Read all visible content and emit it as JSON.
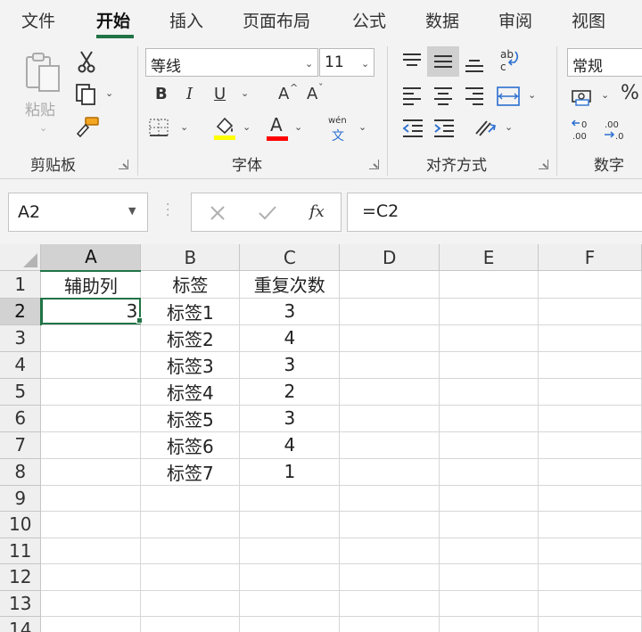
{
  "tabs": [
    "文件",
    "开始",
    "插入",
    "页面布局",
    "公式",
    "数据",
    "审阅",
    "视图"
  ],
  "active_tab": "开始",
  "ribbon": {
    "clipboard": {
      "paste_label": "粘贴",
      "group_label": "剪贴板"
    },
    "font": {
      "font_name": "等线",
      "font_size": "11",
      "bold": "B",
      "italic": "I",
      "underline": "U",
      "grow": "A",
      "shrink": "A",
      "font_color_letter": "A",
      "phonetic_top": "wén",
      "phonetic_bottom": "文",
      "group_label": "字体"
    },
    "alignment": {
      "group_label": "对齐方式"
    },
    "number": {
      "format": "常规",
      "percent": "%",
      "group_label": "数字"
    }
  },
  "formula_bar": {
    "name_box": "A2",
    "fx_label": "fx",
    "formula": "=C2"
  },
  "grid": {
    "columns": [
      "A",
      "B",
      "C",
      "D",
      "E",
      "F"
    ],
    "selected_column": "A",
    "selected_row": 2,
    "active_cell": "A2",
    "rows": [
      {
        "num": "1",
        "cells": [
          "辅助列",
          "标签",
          "重复次数",
          "",
          "",
          ""
        ]
      },
      {
        "num": "2",
        "cells": [
          "3",
          "标签1",
          "3",
          "",
          "",
          ""
        ]
      },
      {
        "num": "3",
        "cells": [
          "",
          "标签2",
          "4",
          "",
          "",
          ""
        ]
      },
      {
        "num": "4",
        "cells": [
          "",
          "标签3",
          "3",
          "",
          "",
          ""
        ]
      },
      {
        "num": "5",
        "cells": [
          "",
          "标签4",
          "2",
          "",
          "",
          ""
        ]
      },
      {
        "num": "6",
        "cells": [
          "",
          "标签5",
          "3",
          "",
          "",
          ""
        ]
      },
      {
        "num": "7",
        "cells": [
          "",
          "标签6",
          "4",
          "",
          "",
          ""
        ]
      },
      {
        "num": "8",
        "cells": [
          "",
          "标签7",
          "1",
          "",
          "",
          ""
        ]
      },
      {
        "num": "9",
        "cells": [
          "",
          "",
          "",
          "",
          "",
          ""
        ]
      },
      {
        "num": "10",
        "cells": [
          "",
          "",
          "",
          "",
          "",
          ""
        ]
      },
      {
        "num": "11",
        "cells": [
          "",
          "",
          "",
          "",
          "",
          ""
        ]
      },
      {
        "num": "12",
        "cells": [
          "",
          "",
          "",
          "",
          "",
          ""
        ]
      },
      {
        "num": "13",
        "cells": [
          "",
          "",
          "",
          "",
          "",
          ""
        ]
      },
      {
        "num": "14",
        "cells": [
          "",
          "",
          "",
          "",
          "",
          ""
        ]
      }
    ]
  },
  "colors": {
    "accent": "#217346",
    "highlight_yellow": "#ffff00",
    "font_red": "#ff0000"
  }
}
